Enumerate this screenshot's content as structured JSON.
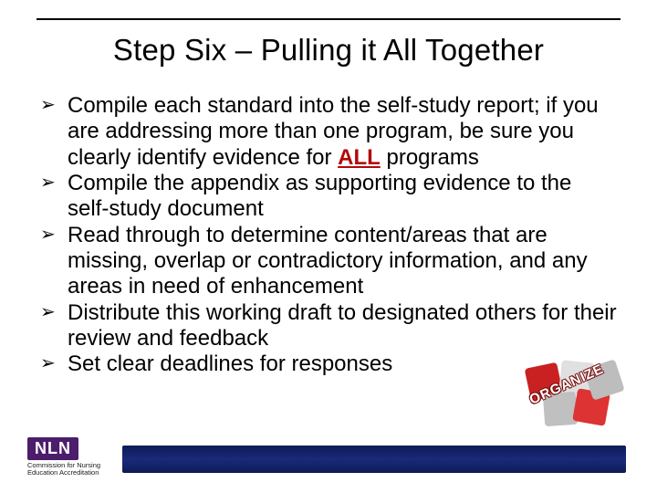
{
  "title": "Step Six – Pulling it All Together",
  "bullets": [
    {
      "pre": "Compile each standard into the self-study report; if you are addressing more than one program, be sure you clearly identify evidence for ",
      "emph": "ALL",
      "post": " programs"
    },
    {
      "pre": "Compile the appendix as supporting evidence to the self-study document",
      "emph": "",
      "post": ""
    },
    {
      "pre": "Read through to determine content/areas that are missing, overlap or contradictory information, and any areas in need of enhancement",
      "emph": "",
      "post": ""
    },
    {
      "pre": "Distribute this working draft to designated others for their review and feedback",
      "emph": "",
      "post": ""
    },
    {
      "pre": "Set clear deadlines for responses",
      "emph": "",
      "post": ""
    }
  ],
  "logo": {
    "abbr": "NLN",
    "line1": "Commission ",
    "line1_italic": "for",
    "line1_end": " Nursing",
    "line2": "Education Accreditation"
  },
  "decor": {
    "puzzle_label": "ORGANIZE"
  }
}
